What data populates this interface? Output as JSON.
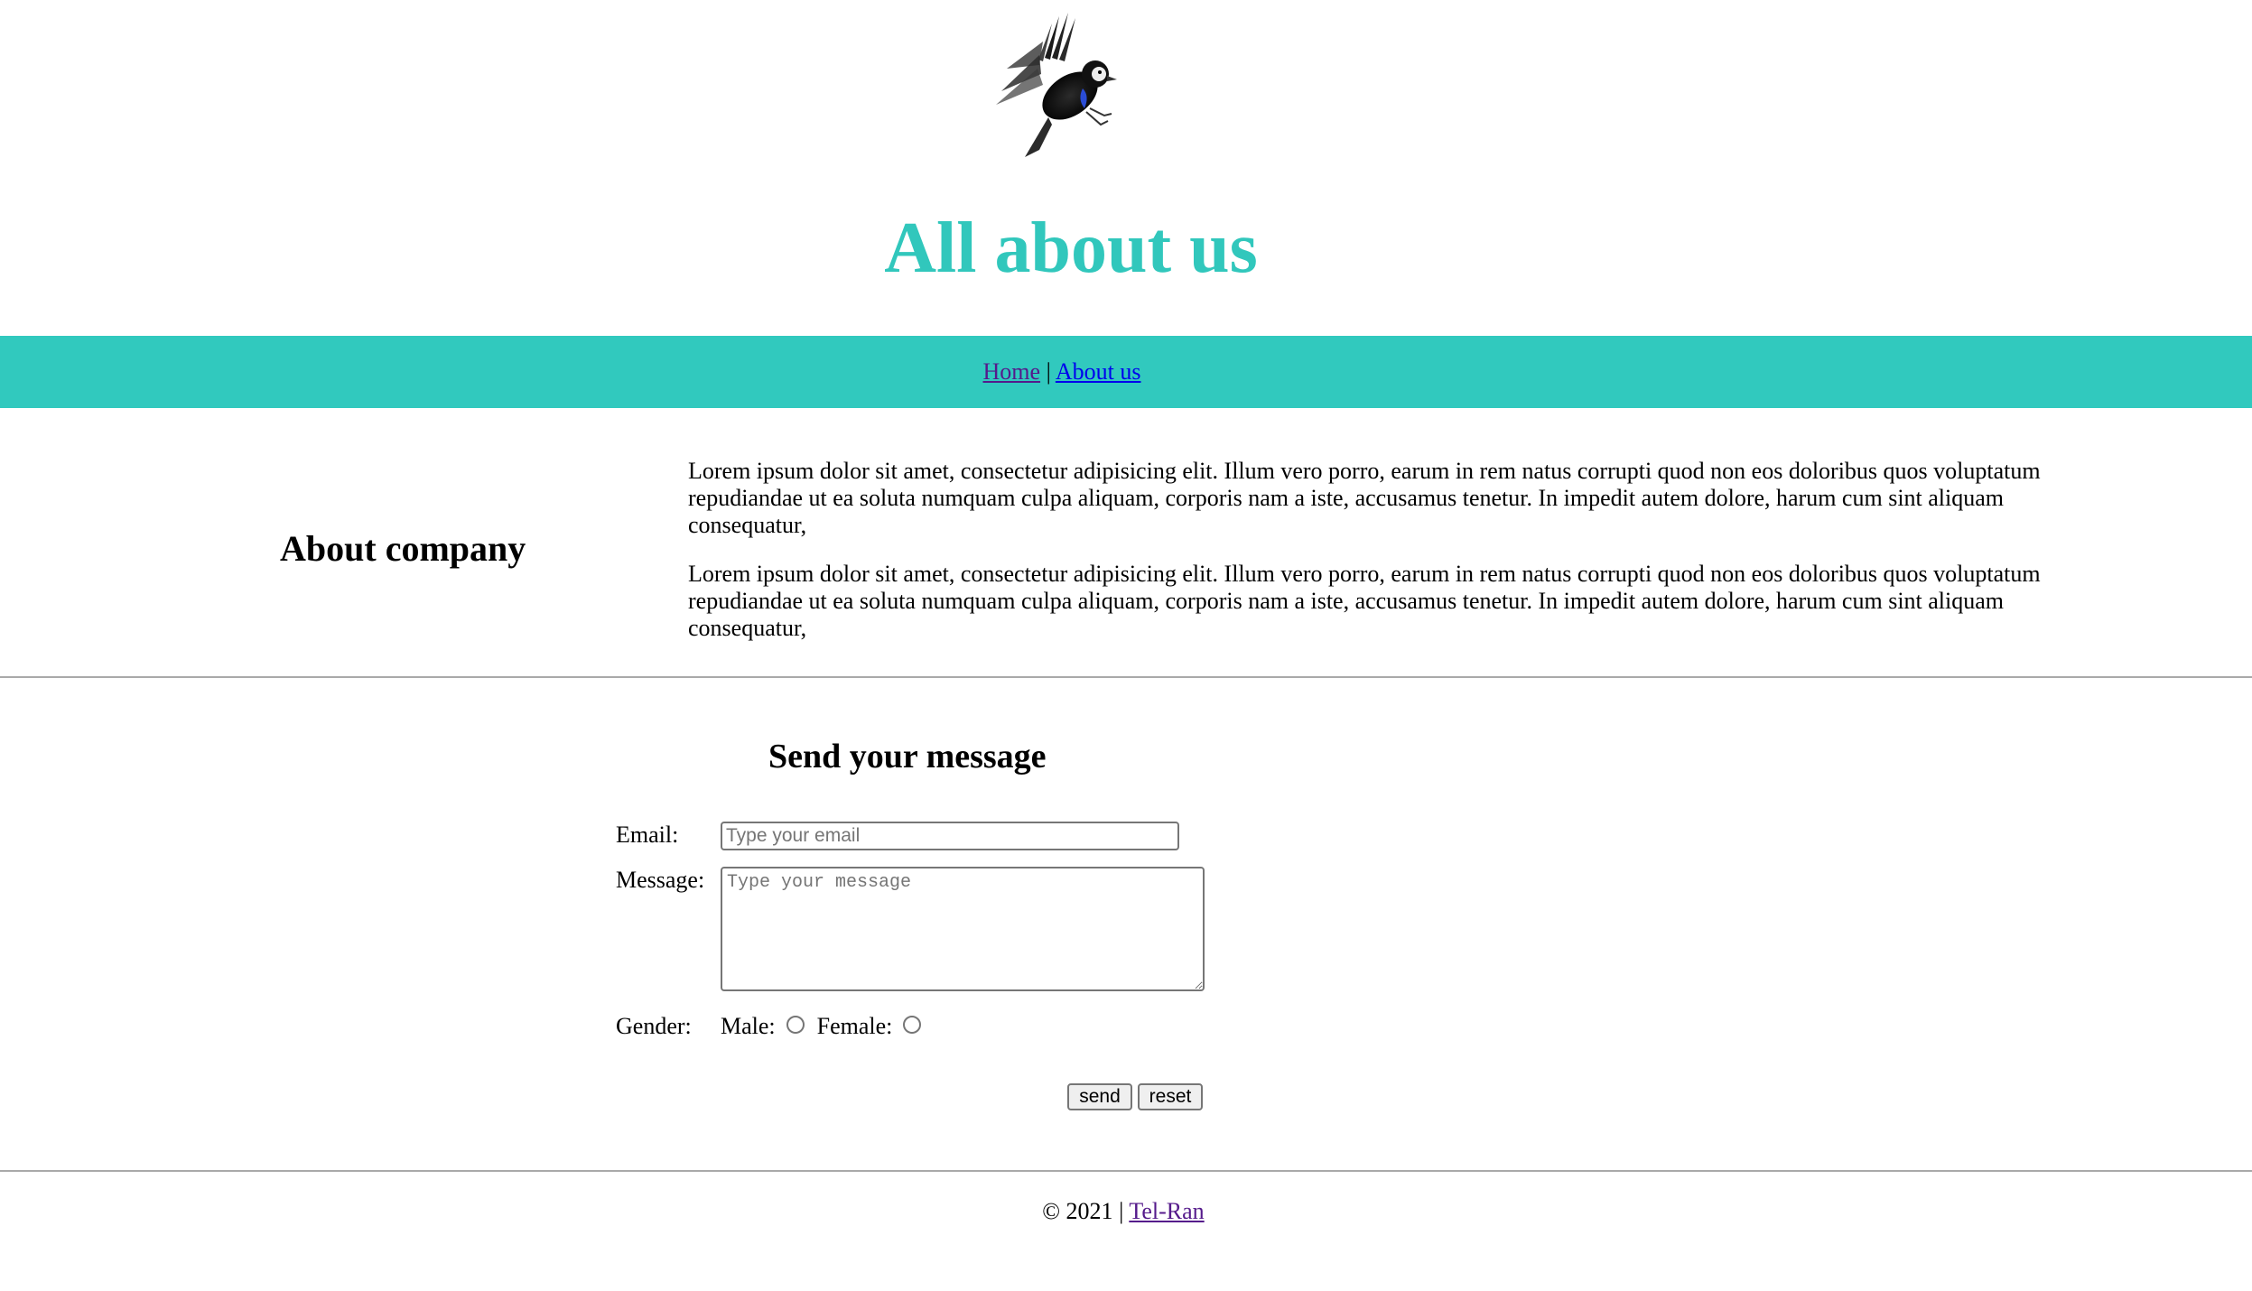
{
  "header": {
    "logo_icon": "bird-logo",
    "title": "All about us",
    "title_color": "#31c7bc"
  },
  "nav": {
    "background_color": "#31c9be",
    "items": [
      {
        "label": "Home"
      },
      {
        "label": "About us"
      }
    ],
    "separator": "|"
  },
  "about": {
    "heading": "About company",
    "paragraphs": [
      "Lorem ipsum dolor sit amet, consectetur adipisicing elit. Illum vero porro, earum in rem natus corrupti quod non eos doloribus quos voluptatum repudiandae ut ea soluta numquam culpa aliquam, corporis nam a iste, accusamus tenetur. In impedit autem dolore, harum cum sint aliquam consequatur,",
      "Lorem ipsum dolor sit amet, consectetur adipisicing elit. Illum vero porro, earum in rem natus corrupti quod non eos doloribus quos voluptatum repudiandae ut ea soluta numquam culpa aliquam, corporis nam a iste, accusamus tenetur. In impedit autem dolore, harum cum sint aliquam consequatur,"
    ]
  },
  "form": {
    "heading": "Send your message",
    "email_label": "Email:",
    "email_placeholder": "Type your email",
    "email_value": "",
    "message_label": "Message:",
    "message_placeholder": "Type your message",
    "message_value": "",
    "gender_label": "Gender:",
    "gender_options": [
      {
        "label": "Male:",
        "checked": false
      },
      {
        "label": "Female:",
        "checked": false
      }
    ],
    "send_label": "send",
    "reset_label": "reset"
  },
  "footer": {
    "copyright": "© 2021",
    "separator": "|",
    "link_label": "Tel-Ran"
  }
}
